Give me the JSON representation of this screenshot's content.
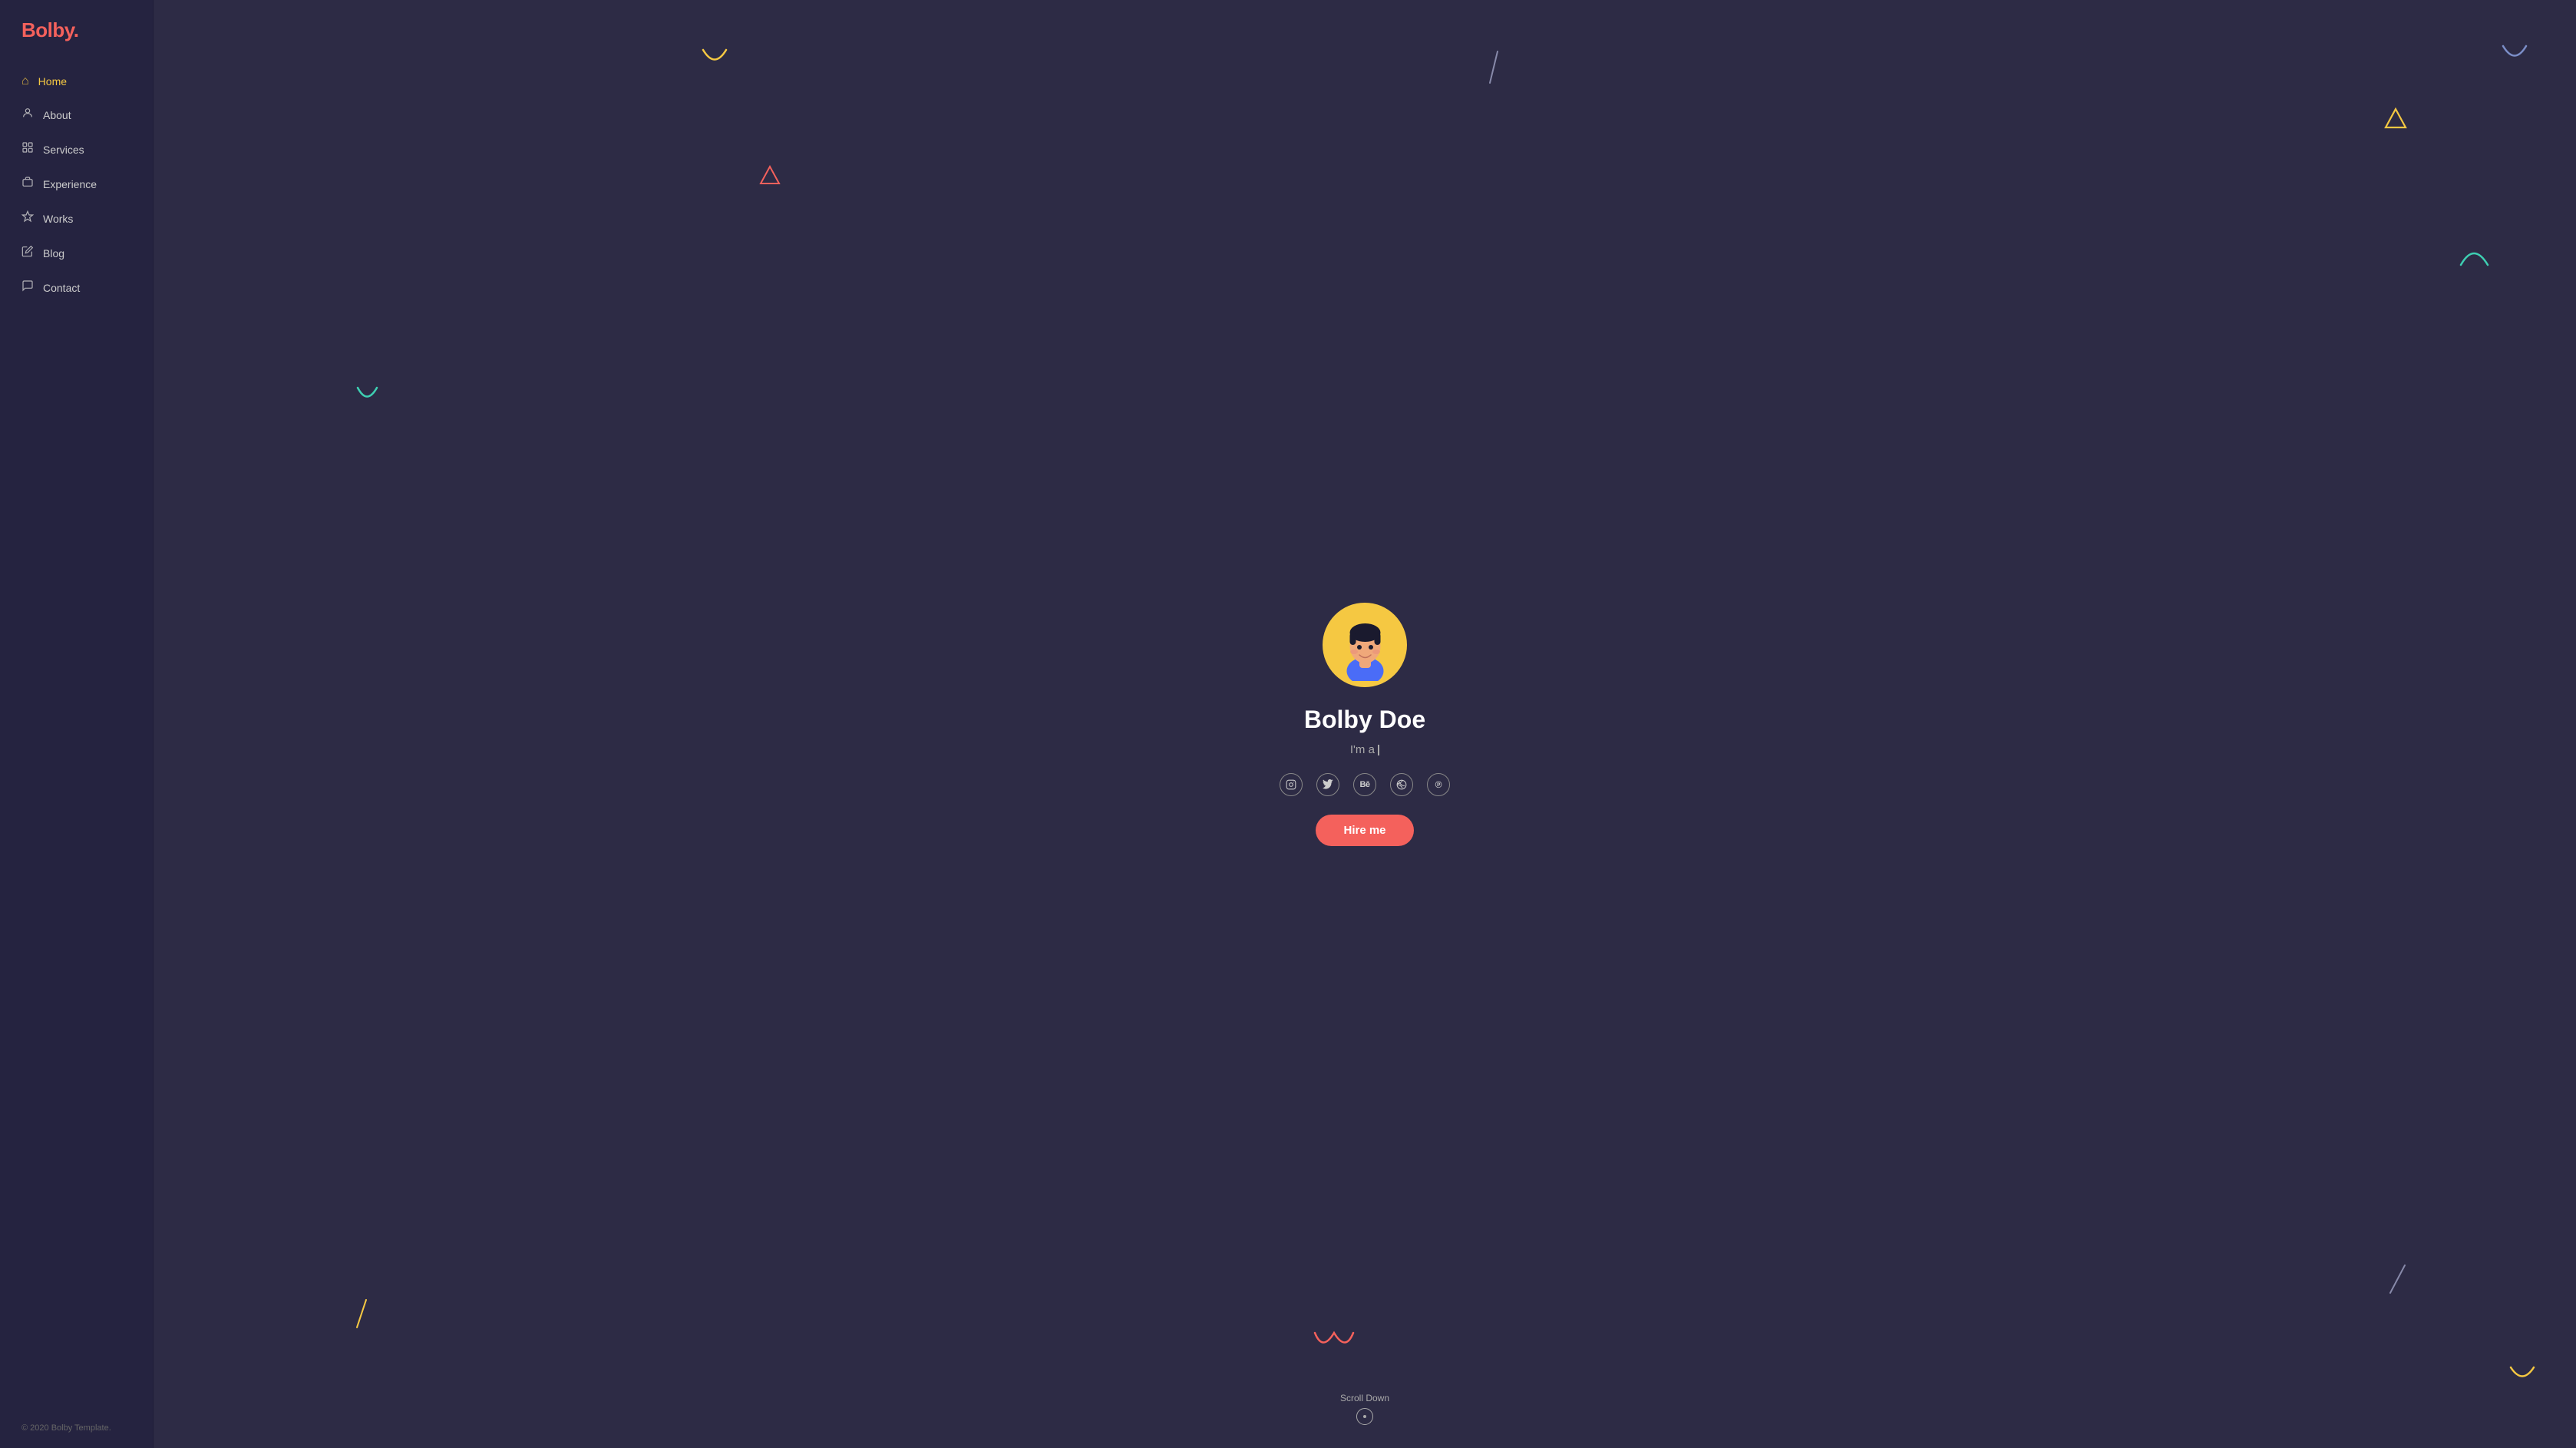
{
  "brand": {
    "name": "Bolby",
    "dot": "."
  },
  "nav": {
    "items": [
      {
        "label": "Home",
        "icon": "⌂",
        "active": true
      },
      {
        "label": "About",
        "icon": "☺",
        "active": false
      },
      {
        "label": "Services",
        "icon": "🗂",
        "active": false
      },
      {
        "label": "Experience",
        "icon": "🎓",
        "active": false
      },
      {
        "label": "Works",
        "icon": "◈",
        "active": false
      },
      {
        "label": "Blog",
        "icon": "✏",
        "active": false
      },
      {
        "label": "Contact",
        "icon": "💬",
        "active": false
      }
    ]
  },
  "footer": {
    "copyright": "© 2020 Bolby Template."
  },
  "hero": {
    "name": "Bolby Doe",
    "subtitle": "I'm a ",
    "hire_label": "Hire me"
  },
  "social": [
    {
      "name": "instagram",
      "icon": "◉"
    },
    {
      "name": "twitter",
      "icon": "𝕋"
    },
    {
      "name": "behance",
      "icon": "𝔹"
    },
    {
      "name": "dribbble",
      "icon": "⊛"
    },
    {
      "name": "pinterest",
      "icon": "℗"
    }
  ],
  "scroll_down": {
    "label": "Scroll Down"
  }
}
